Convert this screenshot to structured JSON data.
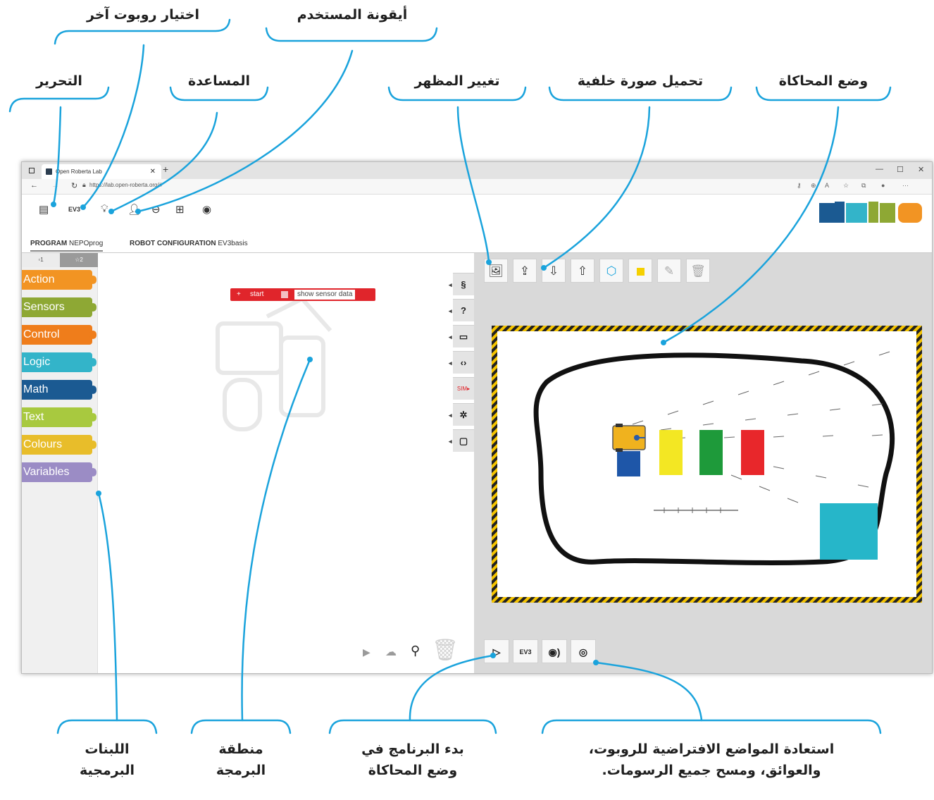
{
  "callouts": {
    "edit": "التحرير",
    "choose_robot": "اختيار روبوت آخر",
    "help": "المساعدة",
    "user_icon": "أيقونة المستخدم",
    "change_view": "تغيير المظهر",
    "upload_background": "تحميل صورة خلفية",
    "sim_mode": "وضع المحاكاة",
    "blocks_line1": "اللبنات",
    "blocks_line2": "البرمجية",
    "workspace_line1": "منطقة",
    "workspace_line2": "البرمجة",
    "start_sim_line1": "بدء البرنامج في",
    "start_sim_line2": "وضع المحاكاة",
    "reset_line1": "استعادة المواضع الافتراضية للروبوت،",
    "reset_line2": "والعوائق، ومسح جميع الرسومات."
  },
  "browser": {
    "tab_title": "Open Roberta Lab",
    "url": "https://lab.open-roberta.org/#"
  },
  "toolbar": {
    "robot_label": "EV3"
  },
  "program_tabs": {
    "program_prefix": "PROGRAM",
    "program_name": "NEPOprog",
    "config_prefix": "ROBOT CONFIGURATION",
    "config_name": "EV3basis"
  },
  "levels": {
    "level1": "1",
    "level2": "2"
  },
  "categories": [
    {
      "label": "Action",
      "color": "#f29423"
    },
    {
      "label": "Sensors",
      "color": "#8ea834"
    },
    {
      "label": "Control",
      "color": "#ef7d1b"
    },
    {
      "label": "Logic",
      "color": "#33b4c9"
    },
    {
      "label": "Math",
      "color": "#1b5a92"
    },
    {
      "label": "Text",
      "color": "#a8c93f"
    },
    {
      "label": "Colours",
      "color": "#e8bd2a"
    },
    {
      "label": "Variables",
      "color": "#9b8cc5"
    }
  ],
  "start_block": {
    "plus": "+",
    "label": "start",
    "sensor_label": "show sensor data"
  },
  "side_buttons": {
    "sim_label": "SIM"
  },
  "sim_bottom": {
    "robot_label": "EV3"
  },
  "colors": {
    "accent_blue": "#1aa3dc",
    "start_red": "#e0252b",
    "frame_yellow": "#f5c400",
    "obstacle_teal": "#26b6c9"
  }
}
